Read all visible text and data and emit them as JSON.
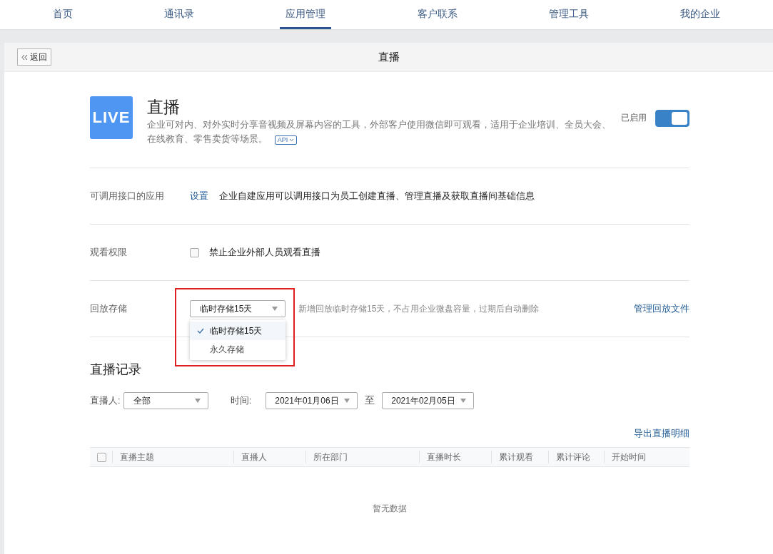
{
  "nav": [
    {
      "label": "首页",
      "selected": false
    },
    {
      "label": "通讯录",
      "selected": false
    },
    {
      "label": "应用管理",
      "selected": true
    },
    {
      "label": "客户联系",
      "selected": false
    },
    {
      "label": "管理工具",
      "selected": false
    },
    {
      "label": "我的企业",
      "selected": false
    }
  ],
  "header": {
    "back": "返回",
    "title": "直播"
  },
  "app": {
    "logo": "LIVE",
    "name": "直播",
    "description": "企业可对内、对外实时分享音视频及屏幕内容的工具，外部客户使用微信即可观看，适用于企业培训、全员大会、在线教育、零售卖货等场景。",
    "api_tag": "API",
    "status": "已启用",
    "enabled": true
  },
  "settings": [
    {
      "kind": "link",
      "label": "可调用接口的应用",
      "link": "设置",
      "text": "企业自建应用可以调用接口为员工创建直播、管理直播及获取直播间基础信息"
    },
    {
      "kind": "checkbox",
      "label": "观看权限",
      "checked": false,
      "text": "禁止企业外部人员观看直播"
    },
    {
      "kind": "select",
      "label": "回放存储",
      "value": "临时存储15天",
      "highlighted": true,
      "expanded": true,
      "options": [
        {
          "label": "临时存储15天",
          "selected": true
        },
        {
          "label": "永久存储",
          "selected": false
        }
      ],
      "hint": "新增回放临时存储15天，不占用企业微盘容量，过期后自动删除",
      "action": "管理回放文件"
    }
  ],
  "records": {
    "title": "直播记录",
    "filters": {
      "host_label": "直播人:",
      "host_value": "全部",
      "time_label": "时间:",
      "from": "2021年01月06日",
      "to_label": "至",
      "to": "2021年02月05日"
    },
    "export": "导出直播明细",
    "table": {
      "select_all": false,
      "columns": [
        "直播主题",
        "直播人",
        "所在部门",
        "直播时长",
        "累计观看",
        "累计评论",
        "开始时间"
      ],
      "empty": "暂无数据"
    }
  }
}
